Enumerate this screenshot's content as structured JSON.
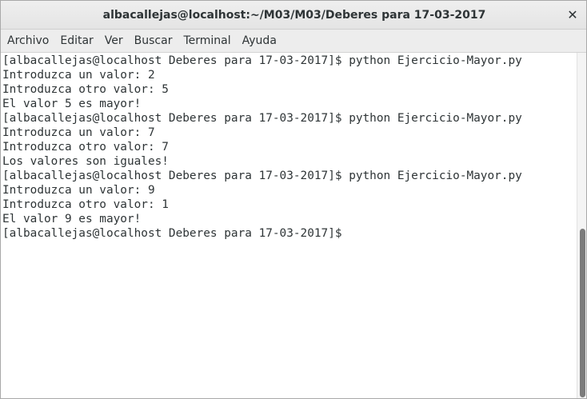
{
  "window": {
    "title": "albacallejas@localhost:~/M03/M03/Deberes para 17-03-2017",
    "close_label": "✕"
  },
  "menubar": {
    "items": [
      {
        "label": "Archivo"
      },
      {
        "label": "Editar"
      },
      {
        "label": "Ver"
      },
      {
        "label": "Buscar"
      },
      {
        "label": "Terminal"
      },
      {
        "label": "Ayuda"
      }
    ]
  },
  "terminal": {
    "lines": [
      "[albacallejas@localhost Deberes para 17-03-2017]$ python Ejercicio-Mayor.py",
      "Introduzca un valor: 2",
      "Introduzca otro valor: 5",
      "El valor 5 es mayor!",
      "[albacallejas@localhost Deberes para 17-03-2017]$ python Ejercicio-Mayor.py",
      "Introduzca un valor: 7",
      "Introduzca otro valor: 7",
      "Los valores son iguales!",
      "[albacallejas@localhost Deberes para 17-03-2017]$ python Ejercicio-Mayor.py",
      "Introduzca un valor: 9",
      "Introduzca otro valor: 1",
      "El valor 9 es mayor!"
    ],
    "prompt": "[albacallejas@localhost Deberes para 17-03-2017]$"
  },
  "colors": {
    "text": "#2e3436",
    "background": "#ffffff",
    "scroll_thumb": "#7b7b7b"
  }
}
